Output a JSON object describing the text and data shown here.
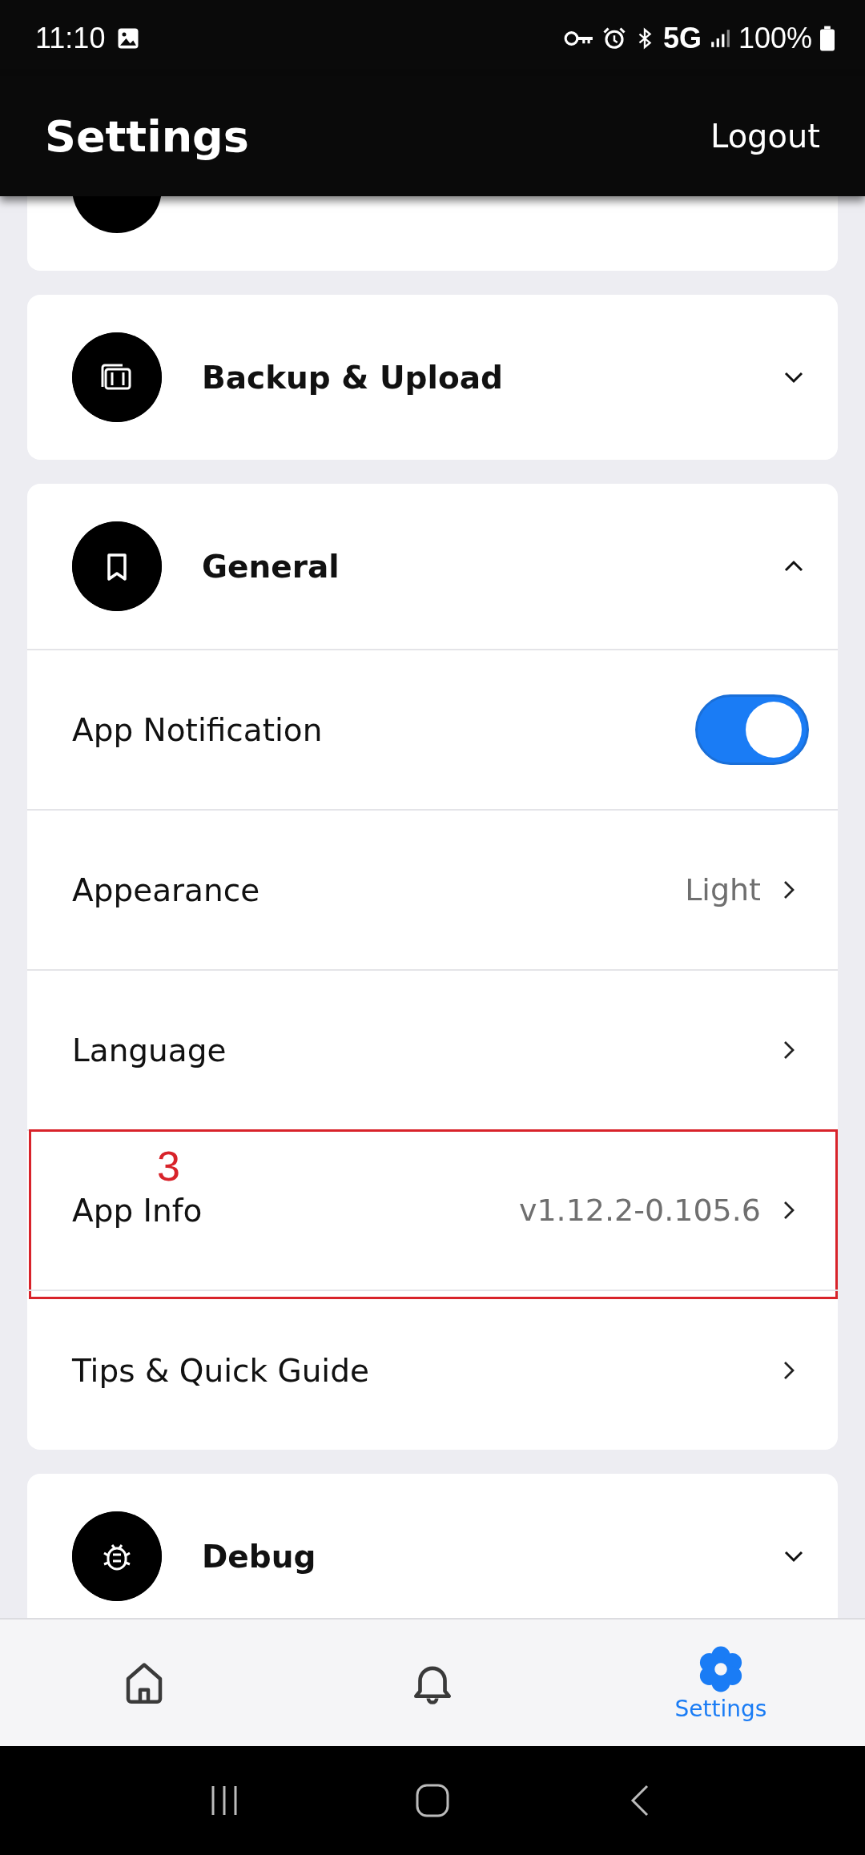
{
  "status_bar": {
    "time": "11:10",
    "network": "5G",
    "battery": "100%"
  },
  "header": {
    "title": "Settings",
    "action": "Logout"
  },
  "sections": [
    {
      "kind": "partial"
    },
    {
      "kind": "group",
      "title": "Backup & Upload",
      "expanded": false
    },
    {
      "kind": "group",
      "title": "General",
      "expanded": true,
      "rows": [
        {
          "kind": "toggle",
          "label": "App Notification",
          "on": true
        },
        {
          "kind": "link",
          "label": "Appearance",
          "value": "Light"
        },
        {
          "kind": "link",
          "label": "Language"
        },
        {
          "kind": "link",
          "label": "App Info",
          "value": "v1.12.2-0.105.6",
          "annotation": "3"
        },
        {
          "kind": "link",
          "label": "Tips & Quick Guide"
        }
      ]
    },
    {
      "kind": "group",
      "title": "Debug",
      "expanded": false
    }
  ],
  "bottom_nav": [
    {
      "selected": false
    },
    {
      "selected": false
    },
    {
      "label": "Settings",
      "selected": true
    }
  ]
}
